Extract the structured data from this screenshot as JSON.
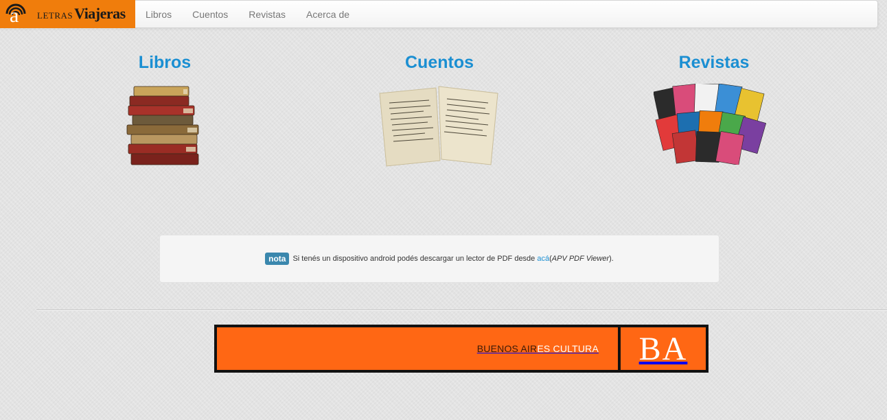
{
  "brand": {
    "mark_letter": "a",
    "small": "LETRAS",
    "big": "Viajeras",
    "color": "#f07d0c"
  },
  "nav": {
    "items": [
      {
        "label": "Libros"
      },
      {
        "label": "Cuentos"
      },
      {
        "label": "Revistas"
      },
      {
        "label": "Acerca de"
      }
    ]
  },
  "categories": {
    "libros": {
      "title": "Libros",
      "image": "stack-of-books-icon"
    },
    "cuentos": {
      "title": "Cuentos",
      "image": "old-papers-icon"
    },
    "revistas": {
      "title": "Revistas",
      "image": "magazines-icon"
    }
  },
  "note": {
    "badge": "nota",
    "text_before": "Si tenés un dispositivo android podés descargar un lector de PDF desde",
    "link": "acá",
    "paren_open": " (",
    "app": "APV PDF Viewer",
    "paren_close": ")."
  },
  "footer": {
    "banner_left_a": "BUENOS AIR",
    "banner_left_b": "ES CULTURA",
    "banner_right": "BA",
    "color": "#ff6714"
  }
}
